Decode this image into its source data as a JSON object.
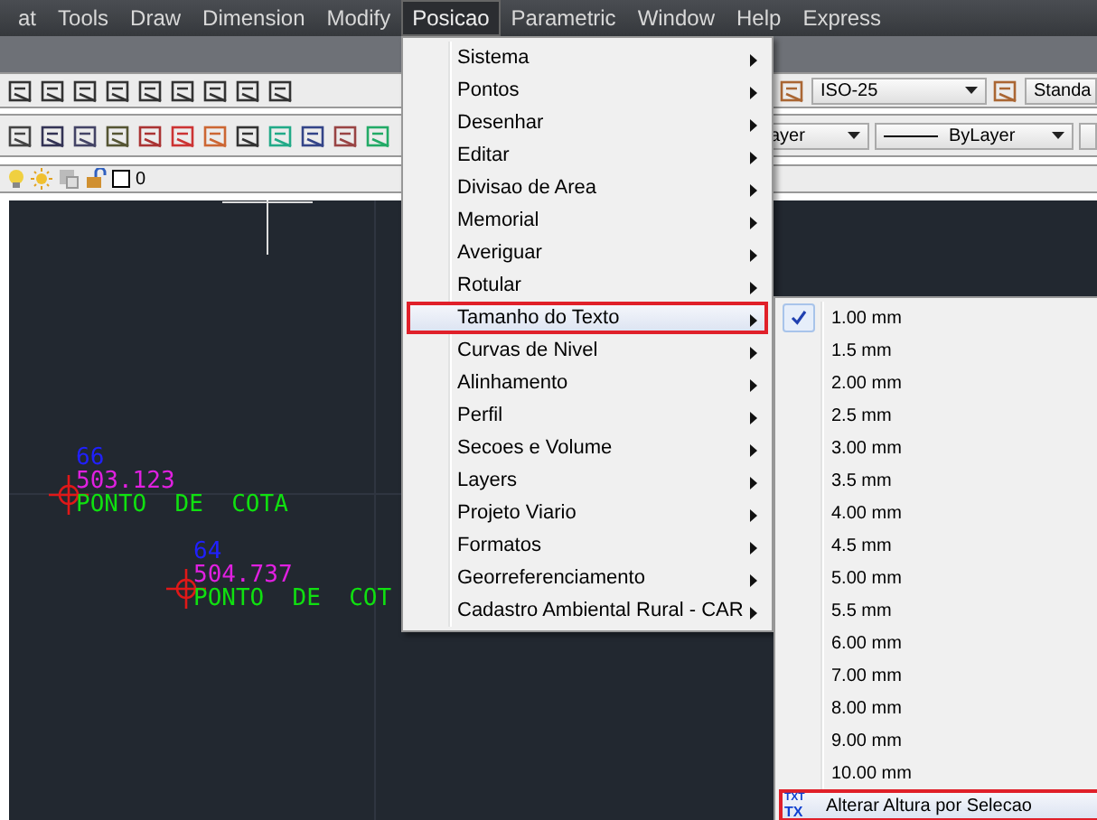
{
  "menu_bar": [
    {
      "label": "at",
      "selected": false
    },
    {
      "label": "Tools",
      "selected": false
    },
    {
      "label": "Draw",
      "selected": false
    },
    {
      "label": "Dimension",
      "selected": false
    },
    {
      "label": "Modify",
      "selected": false
    },
    {
      "label": "Posicao",
      "selected": true
    },
    {
      "label": "Parametric",
      "selected": false
    },
    {
      "label": "Window",
      "selected": false
    },
    {
      "label": "Help",
      "selected": false
    },
    {
      "label": "Express",
      "selected": false
    }
  ],
  "toolbar": {
    "dim_style": "ISO-25",
    "text_style": "Standa",
    "layer_dropdown": "ayer",
    "linetype": "ByLayer",
    "layer": "0"
  },
  "drawing": {
    "points": [
      {
        "number": "66",
        "elevation": "503.123",
        "description": "PONTO  DE  COTA"
      },
      {
        "number": "64",
        "elevation": "504.737",
        "description": "PONTO  DE  COT"
      }
    ]
  },
  "menu": {
    "items": [
      {
        "label": "Sistema",
        "selected": false,
        "submenu": true
      },
      {
        "label": "Pontos",
        "selected": false,
        "submenu": true
      },
      {
        "label": "Desenhar",
        "selected": false,
        "submenu": true
      },
      {
        "label": "Editar",
        "selected": false,
        "submenu": true
      },
      {
        "label": "Divisao de Area",
        "selected": false,
        "submenu": true
      },
      {
        "label": "Memorial",
        "selected": false,
        "submenu": true
      },
      {
        "label": "Averiguar",
        "selected": false,
        "submenu": true
      },
      {
        "label": "Rotular",
        "selected": false,
        "submenu": true
      },
      {
        "label": "Tamanho do Texto",
        "selected": true,
        "submenu": true
      },
      {
        "label": "Curvas de Nivel",
        "selected": false,
        "submenu": true
      },
      {
        "label": "Alinhamento",
        "selected": false,
        "submenu": true
      },
      {
        "label": "Perfil",
        "selected": false,
        "submenu": true
      },
      {
        "label": "Secoes e Volume",
        "selected": false,
        "submenu": true
      },
      {
        "label": "Layers",
        "selected": false,
        "submenu": true
      },
      {
        "label": "Projeto Viario",
        "selected": false,
        "submenu": true
      },
      {
        "label": "Formatos",
        "selected": false,
        "submenu": true
      },
      {
        "label": "Georreferenciamento",
        "selected": false,
        "submenu": true
      },
      {
        "label": "Cadastro Ambiental Rural - CAR",
        "selected": false,
        "submenu": true
      }
    ]
  },
  "submenu": {
    "items": [
      {
        "label": "1.00 mm",
        "checked": true
      },
      {
        "label": "1.5 mm",
        "checked": false
      },
      {
        "label": "2.00 mm",
        "checked": false
      },
      {
        "label": "2.5 mm",
        "checked": false
      },
      {
        "label": "3.00 mm",
        "checked": false
      },
      {
        "label": "3.5 mm",
        "checked": false
      },
      {
        "label": "4.00 mm",
        "checked": false
      },
      {
        "label": "4.5 mm",
        "checked": false
      },
      {
        "label": "5.00 mm",
        "checked": false
      },
      {
        "label": "5.5 mm",
        "checked": false
      },
      {
        "label": "6.00 mm",
        "checked": false
      },
      {
        "label": "7.00 mm",
        "checked": false
      },
      {
        "label": "8.00 mm",
        "checked": false
      },
      {
        "label": "9.00 mm",
        "checked": false
      },
      {
        "label": "10.00 mm",
        "checked": false
      }
    ],
    "action": {
      "label": "Alterar Altura por Selecao",
      "icon_top": "TXT",
      "icon_bottom": "TX",
      "selected": true
    }
  }
}
